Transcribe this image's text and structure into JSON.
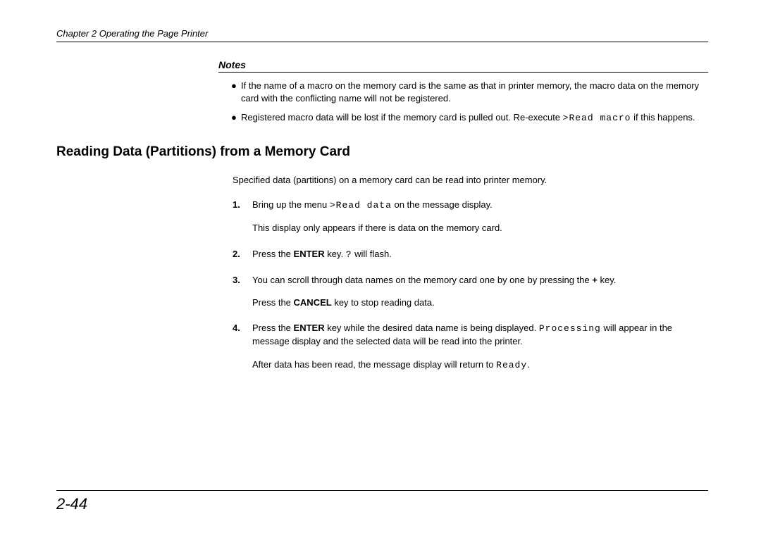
{
  "header": {
    "chapter": "Chapter 2  Operating the Page Printer"
  },
  "notes": {
    "title": "Notes",
    "items": [
      {
        "text": "If the name of a macro on the memory card is the same as that in printer memory, the macro data on the memory card with the conflicting name will not be registered."
      },
      {
        "pre": "Registered macro data will be lost if the memory card is pulled out. Re-execute ",
        "code": ">Read macro",
        "post": " if this happens."
      }
    ]
  },
  "section": {
    "heading": "Reading Data (Partitions) from a Memory Card",
    "intro": "Specified data (partitions) on a memory card can be read into printer memory.",
    "steps": [
      {
        "num": "1.",
        "p1_pre": "Bring up the menu ",
        "p1_code": ">Read data",
        "p1_post": " on the message display.",
        "p2": "This display only appears if there is data on the memory card."
      },
      {
        "num": "2.",
        "p1_pre": "Press the ",
        "p1_bold": "ENTER",
        "p1_mid": " key. ",
        "p1_code": "?",
        "p1_post": " will flash."
      },
      {
        "num": "3.",
        "p1_pre": "You can scroll through data names on the memory card one by one by pressing the ",
        "p1_bold": "+",
        "p1_post": " key.",
        "p2_pre": "Press the ",
        "p2_bold": "CANCEL",
        "p2_post": " key to stop reading data."
      },
      {
        "num": "4.",
        "p1_pre": "Press the ",
        "p1_bold": "ENTER",
        "p1_mid": " key while the desired data name is being displayed. ",
        "p1_code": "Processing",
        "p1_post": " will appear in the message display and the selected data will be read into the printer.",
        "p2_pre": "After data has been read, the message display will return to ",
        "p2_code": "Ready",
        "p2_post": "."
      }
    ]
  },
  "footer": {
    "page": "2-44"
  }
}
